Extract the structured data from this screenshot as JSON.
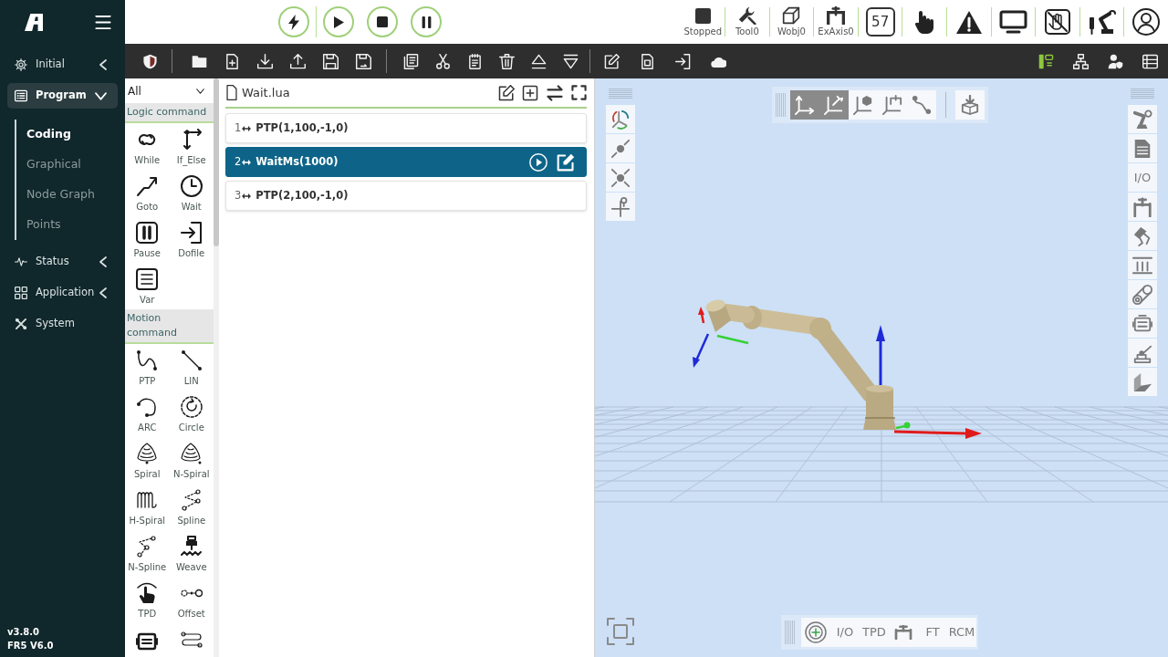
{
  "sidebar": {
    "nav": [
      {
        "label": "Initial",
        "selected": false,
        "expanded": false
      },
      {
        "label": "Program",
        "selected": true,
        "expanded": true,
        "children": [
          {
            "label": "Coding",
            "selected": true
          },
          {
            "label": "Graphical",
            "selected": false
          },
          {
            "label": "Node Graph",
            "selected": false
          },
          {
            "label": "Points",
            "selected": false
          }
        ]
      },
      {
        "label": "Status",
        "selected": false,
        "expanded": false
      },
      {
        "label": "Application",
        "selected": false,
        "expanded": false
      },
      {
        "label": "System",
        "selected": false
      }
    ],
    "version": [
      "v3.8.0",
      "FR5 V6.0"
    ]
  },
  "top_bar": {
    "status_items": [
      {
        "label": "Stopped"
      },
      {
        "label": "Tool0"
      },
      {
        "label": "Wobj0"
      },
      {
        "label": "ExAxis0"
      }
    ],
    "number_display": "57"
  },
  "command_palette": {
    "filter": {
      "value": "All"
    },
    "sections": [
      {
        "title": "Logic command",
        "commands": [
          "While",
          "If_Else",
          "Goto",
          "Wait",
          "Pause",
          "Dofile",
          "Var"
        ]
      },
      {
        "title": "Motion command",
        "commands": [
          "PTP",
          "LIN",
          "ARC",
          "Circle",
          "Spiral",
          "N-Spiral",
          "H-Spiral",
          "Spline",
          "N-Spline",
          "Weave",
          "TPD",
          "Offset"
        ]
      }
    ]
  },
  "editor": {
    "file_name": "Wait.lua",
    "lines": [
      {
        "number": "1",
        "code": "PTP(1,100,-1,0)",
        "selected": false
      },
      {
        "number": "2",
        "code": "WaitMs(1000)",
        "selected": true
      },
      {
        "number": "3",
        "code": "PTP(2,100,-1,0)",
        "selected": false
      }
    ]
  },
  "viewport": {
    "frame_buttons": [
      {
        "selected": true
      },
      {
        "selected": true
      },
      {
        "selected": false
      },
      {
        "selected": false
      },
      {
        "selected": false
      }
    ],
    "side_toolbar_label": "I/O",
    "bottom_toolbar": [
      "I/O",
      "TPD",
      "FT",
      "RCM"
    ]
  }
}
